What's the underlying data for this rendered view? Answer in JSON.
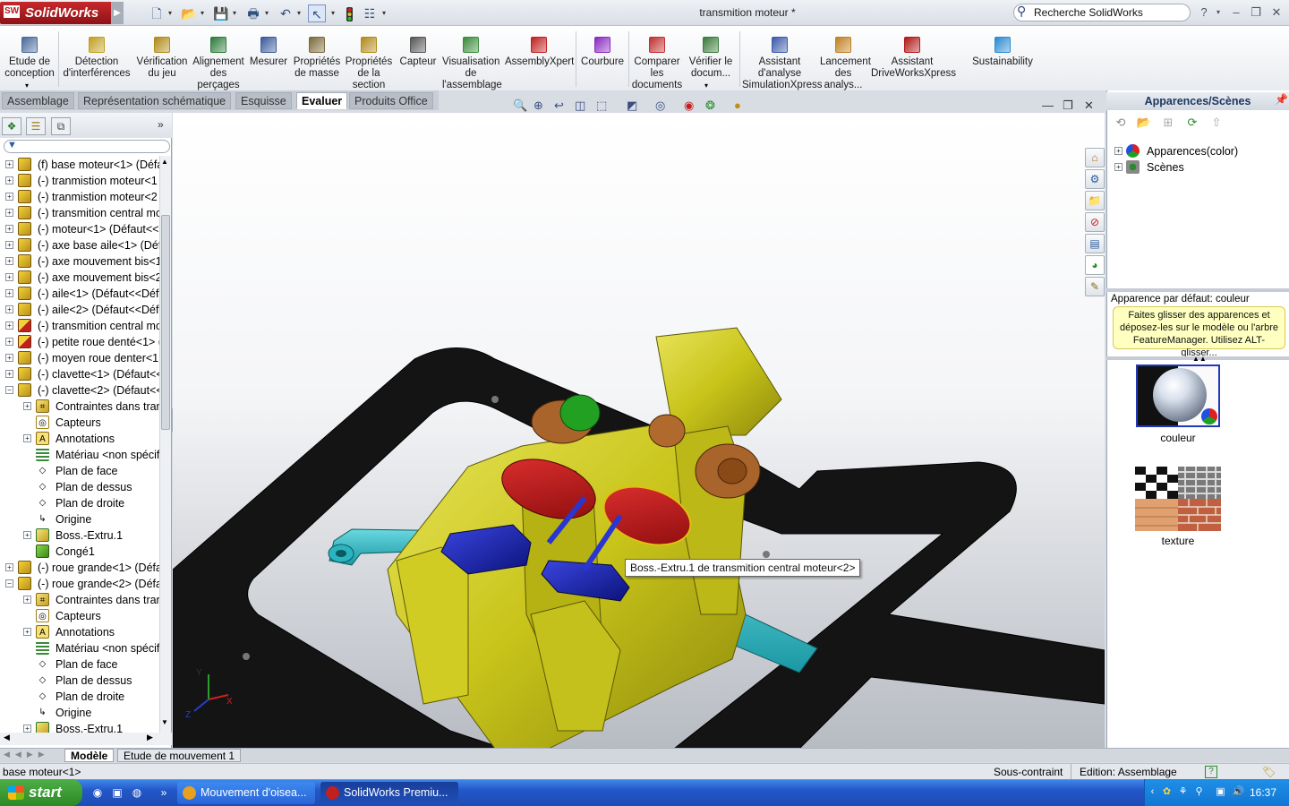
{
  "app": {
    "brand": "SolidWorks",
    "brand_mark": "SW",
    "document_title": "transmition moteur *",
    "search_placeholder": "Recherche SolidWorks"
  },
  "window_buttons": {
    "help": "?",
    "minimize": "–",
    "restore": "❐",
    "close": "✕"
  },
  "command_manager": [
    {
      "label": "Etude de conception",
      "icon": "design-study-icon",
      "color": "#4a6a9a"
    },
    {
      "label": "Détection d'interférences",
      "icon": "interference-icon",
      "color": "#c0a020"
    },
    {
      "label": "Vérification du jeu",
      "icon": "clearance-icon",
      "color": "#b08a18"
    },
    {
      "label": "Alignement des perçages",
      "icon": "hole-alignment-icon",
      "color": "#2d7a3a"
    },
    {
      "label": "Mesurer",
      "icon": "measure-icon",
      "color": "#3a5a9a"
    },
    {
      "label": "Propriétés de masse",
      "icon": "mass-props-icon",
      "color": "#7a6a3a"
    },
    {
      "label": "Propriétés de la section",
      "icon": "section-props-icon",
      "color": "#b08a18"
    },
    {
      "label": "Capteur",
      "icon": "sensor-icon",
      "color": "#555555"
    },
    {
      "label": "Visualisation de l'assemblage",
      "icon": "assembly-vis-icon",
      "color": "#3a8a3a"
    },
    {
      "label": "AssemblyXpert",
      "icon": "assemblyxpert-icon",
      "color": "#c02020"
    },
    {
      "label": "Courbure",
      "icon": "curvature-icon",
      "color": "#8a2ac0"
    },
    {
      "label": "Comparer les documents",
      "icon": "compare-icon",
      "color": "#c03030"
    },
    {
      "label": "Vérifier le docum...",
      "icon": "check-doc-icon",
      "color": "#3a7a3a"
    },
    {
      "label": "Assistant d'analyse SimulationXpress",
      "icon": "simulationxpress-icon",
      "color": "#3a5aaa"
    },
    {
      "label": "Lancement des analys...",
      "icon": "analysis-launch-icon",
      "color": "#c08020"
    },
    {
      "label": "Assistant DriveWorksXpress",
      "icon": "driveworks-icon",
      "color": "#b01818"
    },
    {
      "label": "Sustainability",
      "icon": "sustainability-icon",
      "color": "#2a8ad0"
    }
  ],
  "cm_tabs": [
    "Assemblage",
    "Représentation schématique",
    "Esquisse",
    "Evaluer",
    "Produits Office"
  ],
  "cm_active_tab": "Evaluer",
  "feature_tree": [
    {
      "label": "(f) base moteur<1> (Défa",
      "level": 0,
      "expander": "+",
      "icon": "part-icon"
    },
    {
      "label": "(-) tranmistion moteur<1",
      "level": 0,
      "expander": "+",
      "icon": "part-icon"
    },
    {
      "label": "(-) tranmistion moteur<2",
      "level": 0,
      "expander": "+",
      "icon": "part-icon"
    },
    {
      "label": "(-) transmition central mo",
      "level": 0,
      "expander": "+",
      "icon": "part-icon"
    },
    {
      "label": "(-) moteur<1> (Défaut<<",
      "level": 0,
      "expander": "+",
      "icon": "part-icon"
    },
    {
      "label": "(-) axe base aile<1> (Défa",
      "level": 0,
      "expander": "+",
      "icon": "part-icon"
    },
    {
      "label": "(-) axe mouvement bis<1",
      "level": 0,
      "expander": "+",
      "icon": "part-icon"
    },
    {
      "label": "(-) axe mouvement bis<2",
      "level": 0,
      "expander": "+",
      "icon": "part-icon"
    },
    {
      "label": "(-) aile<1> (Défaut<<Défa",
      "level": 0,
      "expander": "+",
      "icon": "part-icon"
    },
    {
      "label": "(-) aile<2> (Défaut<<Défa",
      "level": 0,
      "expander": "+",
      "icon": "part-icon"
    },
    {
      "label": "(-) transmition central mo",
      "level": 0,
      "expander": "+",
      "icon": "subassembly-icon"
    },
    {
      "label": "(-) petite roue denté<1> (",
      "level": 0,
      "expander": "+",
      "icon": "subassembly-icon"
    },
    {
      "label": "(-) moyen roue denter<1:",
      "level": 0,
      "expander": "+",
      "icon": "part-icon"
    },
    {
      "label": "(-) clavette<1> (Défaut<<",
      "level": 0,
      "expander": "+",
      "icon": "part-icon"
    },
    {
      "label": "(-) clavette<2> (Défaut<<",
      "level": 0,
      "expander": "−",
      "icon": "part-icon"
    },
    {
      "label": "Contraintes dans trans",
      "level": 1,
      "expander": "+",
      "icon": "mates-icon"
    },
    {
      "label": "Capteurs",
      "level": 1,
      "expander": "",
      "icon": "sensors-icon"
    },
    {
      "label": "Annotations",
      "level": 1,
      "expander": "+",
      "icon": "annotations-icon"
    },
    {
      "label": "Matériau <non spécifi",
      "level": 1,
      "expander": "",
      "icon": "material-icon"
    },
    {
      "label": "Plan de face",
      "level": 1,
      "expander": "",
      "icon": "plane-icon"
    },
    {
      "label": "Plan de dessus",
      "level": 1,
      "expander": "",
      "icon": "plane-icon"
    },
    {
      "label": "Plan de droite",
      "level": 1,
      "expander": "",
      "icon": "plane-icon"
    },
    {
      "label": "Origine",
      "level": 1,
      "expander": "",
      "icon": "origin-icon"
    },
    {
      "label": "Boss.-Extru.1",
      "level": 1,
      "expander": "+",
      "icon": "extrude-icon"
    },
    {
      "label": "Congé1",
      "level": 1,
      "expander": "",
      "icon": "fillet-icon"
    },
    {
      "label": "(-) roue grande<1> (Défa",
      "level": 0,
      "expander": "+",
      "icon": "part-icon"
    },
    {
      "label": "(-) roue grande<2> (Défa",
      "level": 0,
      "expander": "−",
      "icon": "part-icon"
    },
    {
      "label": "Contraintes dans trans",
      "level": 1,
      "expander": "+",
      "icon": "mates-icon"
    },
    {
      "label": "Capteurs",
      "level": 1,
      "expander": "",
      "icon": "sensors-icon"
    },
    {
      "label": "Annotations",
      "level": 1,
      "expander": "+",
      "icon": "annotations-icon"
    },
    {
      "label": "Matériau <non spécifi",
      "level": 1,
      "expander": "",
      "icon": "material-icon"
    },
    {
      "label": "Plan de face",
      "level": 1,
      "expander": "",
      "icon": "plane-icon"
    },
    {
      "label": "Plan de dessus",
      "level": 1,
      "expander": "",
      "icon": "plane-icon"
    },
    {
      "label": "Plan de droite",
      "level": 1,
      "expander": "",
      "icon": "plane-icon"
    },
    {
      "label": "Origine",
      "level": 1,
      "expander": "",
      "icon": "origin-icon"
    },
    {
      "label": "Boss.-Extru.1",
      "level": 1,
      "expander": "+",
      "icon": "extrude-icon"
    }
  ],
  "bottom_tabs": [
    "Modèle",
    "Etude de mouvement 1"
  ],
  "bottom_active_tab": "Modèle",
  "viewport": {
    "tooltip": "Boss.-Extru.1 de transmition central moteur<2>",
    "axis_labels": {
      "x": "X",
      "y": "Y",
      "z": "Z"
    },
    "colors": {
      "frame": "#141414",
      "housing": "#c8c41a",
      "lobe": "#b01414",
      "arm": "#2ab4c0",
      "link": "#1a22b0",
      "wheel": "#a8642a",
      "gear": "#22a022"
    }
  },
  "right_panel": {
    "title": "Apparences/Scènes",
    "tree": [
      {
        "label": "Apparences(color)",
        "icon": "appearances-icon"
      },
      {
        "label": "Scènes",
        "icon": "scenes-icon"
      }
    ],
    "subtitle": "Apparence par défaut: couleur",
    "note": "Faites glisser des apparences et déposez-les sur le modèle ou l'arbre FeatureManager. Utilisez ALT-glisser...",
    "swatches": [
      {
        "label": "couleur",
        "icon": "chrome-sphere-icon"
      },
      {
        "label": "texture",
        "icon": "texture-swatch-icon"
      }
    ]
  },
  "status_bar": {
    "left": "base moteur<1>",
    "state": "Sous-contraint",
    "mode": "Edition: Assemblage"
  },
  "taskbar": {
    "start": "start",
    "tasks": [
      {
        "label": "Mouvement d'oisea...",
        "icon": "chrome-icon",
        "color": "#e8a020"
      },
      {
        "label": "SolidWorks Premiu...",
        "icon": "solidworks-icon",
        "color": "#c02020"
      }
    ],
    "clock": "16:37"
  }
}
